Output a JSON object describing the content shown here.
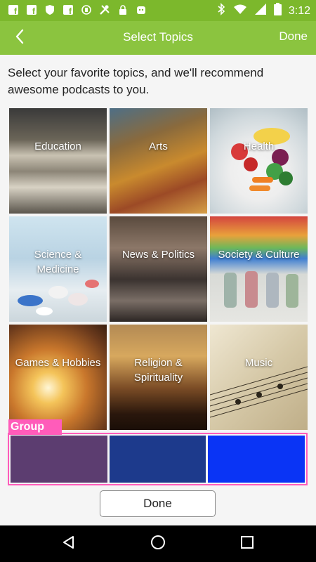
{
  "status_bar": {
    "time": "3:12",
    "left_icons": [
      "facebook-icon",
      "facebook-icon",
      "shield-icon",
      "facebook-icon",
      "circle-icon",
      "tools-icon",
      "lock-icon",
      "android-icon"
    ],
    "right_icons": [
      "bluetooth-icon",
      "wifi-icon",
      "signal-icon",
      "battery-icon"
    ]
  },
  "header": {
    "back_icon": "chevron-left-icon",
    "title": "Select Topics",
    "done_label": "Done"
  },
  "intro_text": "Select your favorite topics, and we'll recommend awesome podcasts to you.",
  "topics": [
    {
      "label": "Education"
    },
    {
      "label": "Arts"
    },
    {
      "label": "Health"
    },
    {
      "label": "Science & Medicine"
    },
    {
      "label": "News & Politics"
    },
    {
      "label": "Society & Culture"
    },
    {
      "label": "Games & Hobbies"
    },
    {
      "label": "Religion & Spirituality"
    },
    {
      "label": "Music"
    }
  ],
  "group": {
    "label": "Group",
    "swatches": [
      "#5c3d70",
      "#1d3a8c",
      "#0a34f5"
    ]
  },
  "done_button_label": "Done",
  "nav_bar": {
    "icons": [
      "back-triangle-icon",
      "home-circle-icon",
      "recents-square-icon"
    ]
  },
  "colors": {
    "header_green": "#8bc43f",
    "status_green": "#7cb82c",
    "group_pink": "#ff5cba"
  }
}
